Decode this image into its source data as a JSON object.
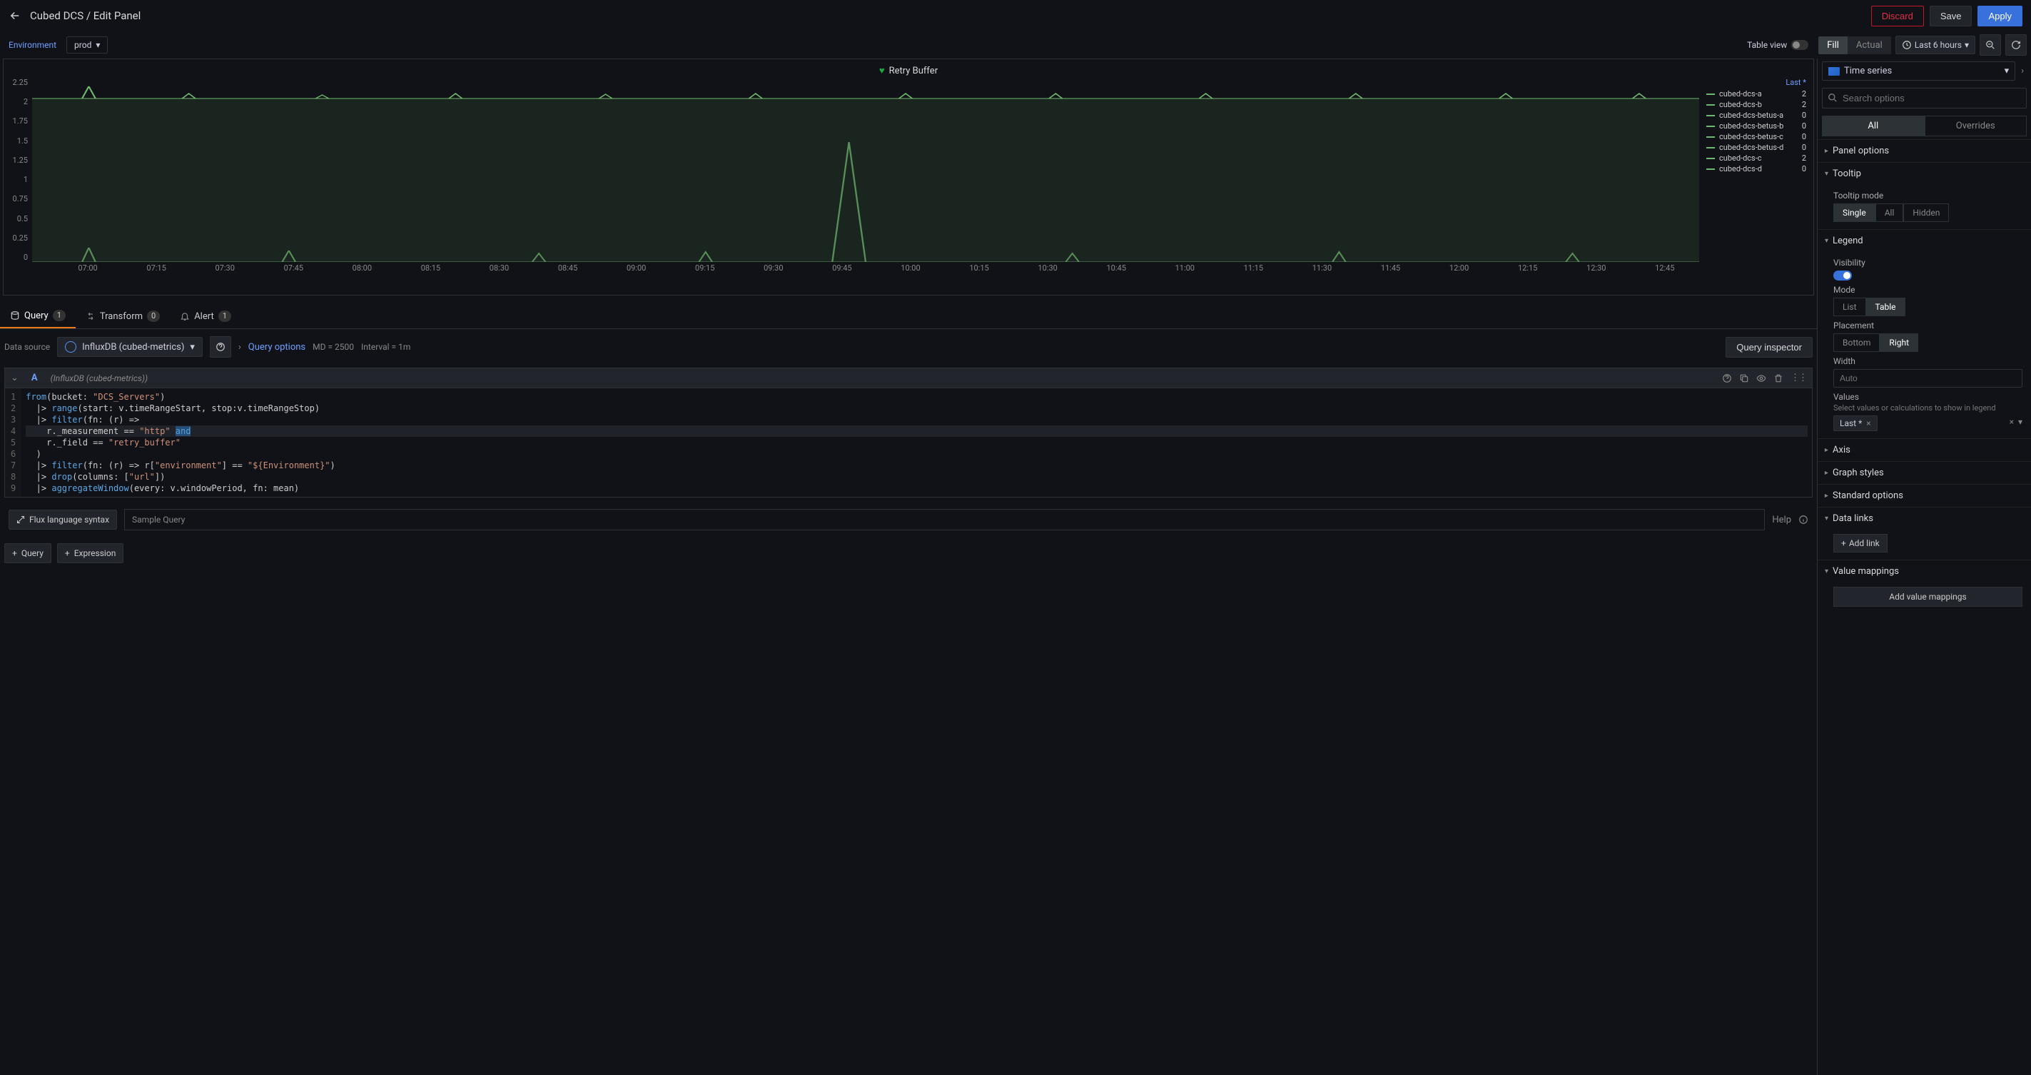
{
  "header": {
    "breadcrumb": "Cubed DCS / Edit Panel",
    "discard": "Discard",
    "save": "Save",
    "apply": "Apply"
  },
  "subheader": {
    "env_label": "Environment",
    "env_value": "prod",
    "table_view": "Table view",
    "fill": "Fill",
    "actual": "Actual",
    "time_range": "Last 6 hours"
  },
  "panel_type": "Time series",
  "chart_data": {
    "type": "line",
    "title": "Retry Buffer",
    "ylim": [
      0,
      2.25
    ],
    "yticks": [
      0,
      0.25,
      0.5,
      0.75,
      1,
      1.25,
      1.5,
      1.75,
      2,
      2.25
    ],
    "xticks": [
      "07:00",
      "07:15",
      "07:30",
      "07:45",
      "08:00",
      "08:15",
      "08:30",
      "08:45",
      "09:00",
      "09:15",
      "09:30",
      "09:45",
      "10:00",
      "10:15",
      "10:30",
      "10:45",
      "11:00",
      "11:15",
      "11:30",
      "11:45",
      "12:00",
      "12:15",
      "12:30",
      "12:45"
    ],
    "series": [
      {
        "name": "cubed-dcs-a",
        "last": 2
      },
      {
        "name": "cubed-dcs-b",
        "last": 2
      },
      {
        "name": "cubed-dcs-betus-a",
        "last": 0
      },
      {
        "name": "cubed-dcs-betus-b",
        "last": 0
      },
      {
        "name": "cubed-dcs-betus-c",
        "last": 0
      },
      {
        "name": "cubed-dcs-betus-d",
        "last": 0
      },
      {
        "name": "cubed-dcs-c",
        "last": 2
      },
      {
        "name": "cubed-dcs-d",
        "last": 0
      }
    ],
    "legend_header": "Last *"
  },
  "tabs": {
    "query": "Query",
    "query_count": "1",
    "transform": "Transform",
    "transform_count": "0",
    "alert": "Alert",
    "alert_count": "1"
  },
  "datasource": {
    "label": "Data source",
    "name": "InfluxDB (cubed-metrics)",
    "query_options": "Query options",
    "md": "MD = 2500",
    "interval": "Interval = 1m",
    "inspector": "Query inspector"
  },
  "query": {
    "letter": "A",
    "ds_hint": "(InfluxDB (cubed-metrics))",
    "lines": [
      "from(bucket: \"DCS_Servers\")",
      "  |> range(start: v.timeRangeStart, stop:v.timeRangeStop)",
      "  |> filter(fn: (r) =>",
      "    r._measurement == \"http\" and",
      "    r._field == \"retry_buffer\"",
      "  )",
      "  |> filter(fn: (r) => r[\"environment\"] == \"${Environment}\")",
      "  |> drop(columns: [\"url\"])",
      "  |> aggregateWindow(every: v.windowPeriod, fn: mean)"
    ]
  },
  "footer": {
    "flux_syntax": "Flux language syntax",
    "sample": "Sample Query",
    "help": "Help",
    "add_query": "Query",
    "add_expression": "Expression"
  },
  "sidebar": {
    "search_placeholder": "Search options",
    "tab_all": "All",
    "tab_overrides": "Overrides",
    "panel_options": "Panel options",
    "tooltip": {
      "title": "Tooltip",
      "mode_label": "Tooltip mode",
      "single": "Single",
      "all": "All",
      "hidden": "Hidden"
    },
    "legend": {
      "title": "Legend",
      "visibility": "Visibility",
      "mode": "Mode",
      "list": "List",
      "table": "Table",
      "placement": "Placement",
      "bottom": "Bottom",
      "right": "Right",
      "width": "Width",
      "width_placeholder": "Auto",
      "values": "Values",
      "values_desc": "Select values or calculations to show in legend",
      "chip": "Last *"
    },
    "axis": "Axis",
    "graph_styles": "Graph styles",
    "standard_options": "Standard options",
    "data_links": {
      "title": "Data links",
      "add": "Add link"
    },
    "value_mappings": {
      "title": "Value mappings",
      "add": "Add value mappings"
    }
  }
}
